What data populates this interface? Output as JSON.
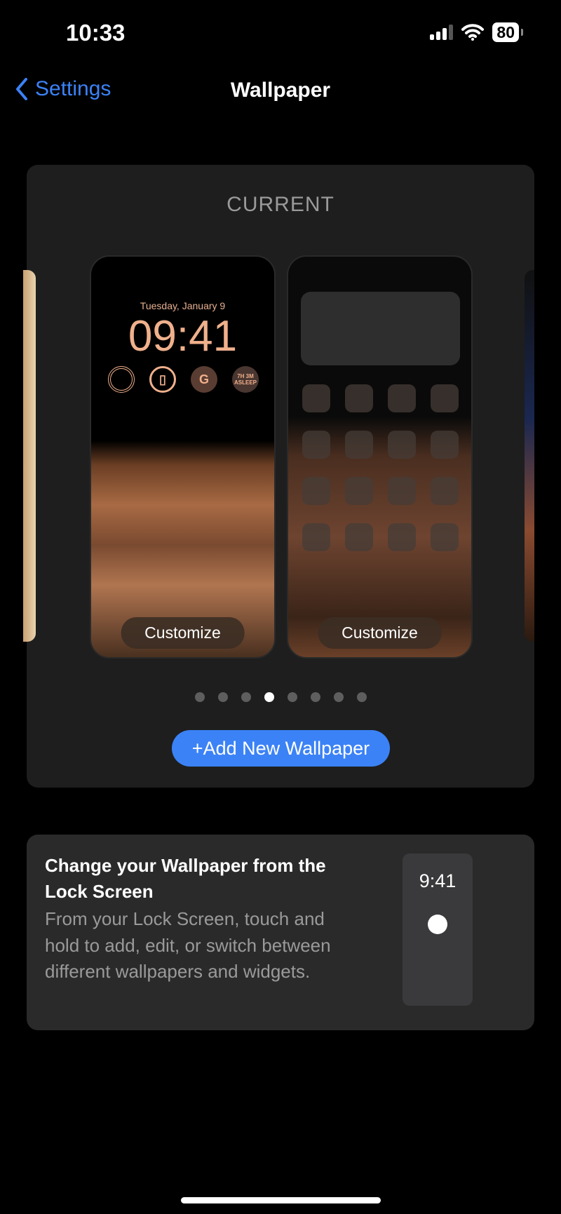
{
  "status_bar": {
    "time": "10:33",
    "battery": "80"
  },
  "nav": {
    "back_label": "Settings",
    "title": "Wallpaper"
  },
  "wallpaper_card": {
    "section_label": "CURRENT",
    "lock_screen": {
      "date": "Tuesday, January 9",
      "time": "09:41",
      "widgets": [
        "activity-rings",
        "watch",
        "G",
        "7H 3M ASLEEP"
      ],
      "customize_label": "Customize"
    },
    "home_screen": {
      "customize_label": "Customize"
    },
    "page_count": 8,
    "current_page": 4,
    "add_button_label": "+Add New Wallpaper"
  },
  "tip_card": {
    "title": "Change your Wallpaper from the Lock Screen",
    "body": "From your Lock Screen, touch and hold to add, edit, or switch between different wallpapers and widgets.",
    "preview_time": "9:41"
  }
}
